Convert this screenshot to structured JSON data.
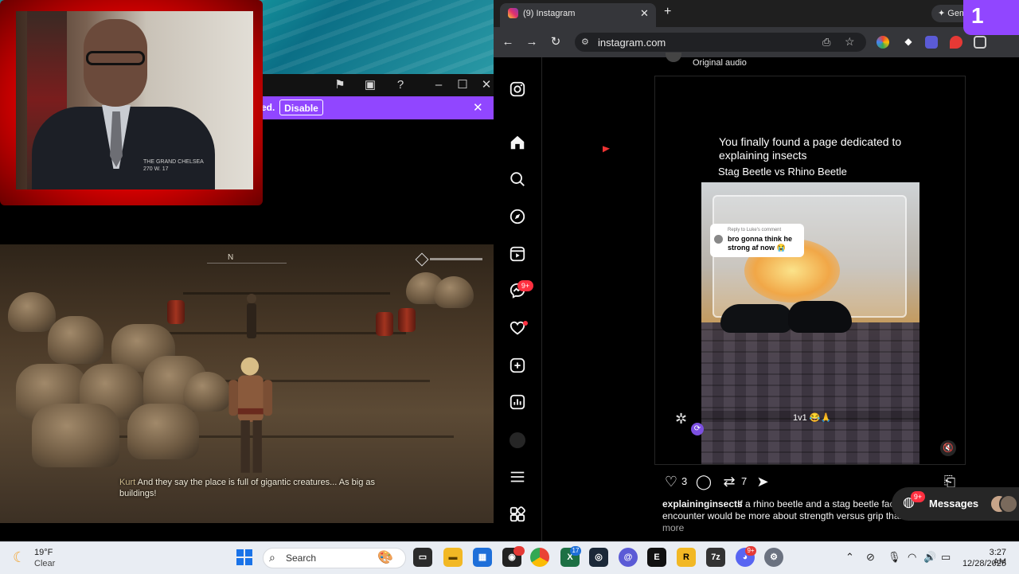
{
  "colors": {
    "twitch_purple": "#9146ff",
    "webcam_frame": "#d10000",
    "instagram_badge": "#ff3040",
    "browser_bg": "#35363a"
  },
  "left_app": {
    "titlebar_icons": [
      "flag-icon",
      "screen-icon",
      "help-icon",
      "minimize-icon",
      "maximize-icon",
      "close-icon"
    ],
    "notification": {
      "text_fragment": "ed.",
      "disable_label": "Disable",
      "close_glyph": "✕"
    },
    "webcam": {
      "jacket_logo": "THE GRAND CHELSEA\n270 W. 17"
    },
    "game": {
      "compass_label": "N",
      "subtitle_speaker": "Kurt",
      "subtitle_text": "And they say the place is full of gigantic creatures... As big as buildings!"
    }
  },
  "browser": {
    "tab": {
      "title": "(9) Instagram",
      "close_glyph": "✕"
    },
    "new_tab_glyph": "+",
    "gemini_label": "✦ Gem",
    "twitch_corner_label": "1",
    "address": {
      "url": "instagram.com"
    },
    "nav": {
      "back": "←",
      "forward": "→",
      "reload": "↻"
    }
  },
  "instagram": {
    "sidebar": {
      "messages_badge": "9+",
      "items": [
        "instagram-logo",
        "home",
        "search",
        "explore",
        "reels",
        "messages",
        "notifications",
        "create",
        "dashboard",
        "profile",
        "more",
        "also-from-meta"
      ]
    },
    "post": {
      "audio": "Original audio",
      "caption_line": "You finally found a page dedicated to explaining insects",
      "caption_subline": "Stag Beetle vs Rhino Beetle",
      "reply_header": "Reply to Luke's comment",
      "reply_text": "bro gonna think he strong af now 😭",
      "video_bottom_text": "1v1 😂🙏",
      "likes": "3",
      "reposts": "7",
      "username": "explaininginsects",
      "text_line1": "If a rhino beetle and a stag beetle face",
      "text_line2": "encounter would be more about strength versus grip than",
      "more_label": "more"
    },
    "messages_pill": {
      "label": "Messages",
      "badge": "9+"
    }
  },
  "taskbar": {
    "weather": {
      "temp": "19°F",
      "condition": "Clear"
    },
    "search_label": "Search",
    "badges": {
      "chrome_dot": "",
      "excel": "17",
      "discord": "9+"
    },
    "clock": {
      "time": "3:27 AM",
      "date": "12/28/2025"
    }
  }
}
